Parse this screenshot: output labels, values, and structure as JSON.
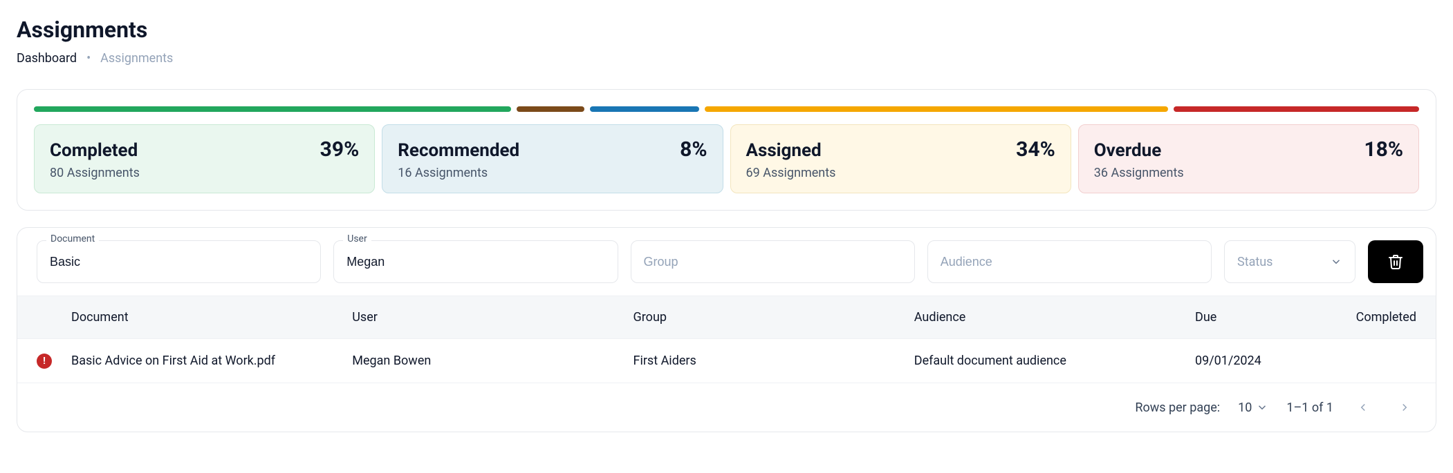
{
  "header": {
    "title": "Assignments"
  },
  "breadcrumb": {
    "items": [
      "Dashboard",
      "Assignments"
    ],
    "separator": "•"
  },
  "progress": {
    "segments": [
      {
        "colorClass": "seg-green",
        "weight": 35
      },
      {
        "colorClass": "seg-brown",
        "weight": 5
      },
      {
        "colorClass": "seg-blue",
        "weight": 8
      },
      {
        "colorClass": "seg-amber",
        "weight": 34
      },
      {
        "colorClass": "seg-red",
        "weight": 18
      }
    ]
  },
  "stats": {
    "completed": {
      "title": "Completed",
      "percent": "39%",
      "subtitle": "80 Assignments",
      "boxClass": "box-completed"
    },
    "recommended": {
      "title": "Recommended",
      "percent": "8%",
      "subtitle": "16 Assignments",
      "boxClass": "box-recommended"
    },
    "assigned": {
      "title": "Assigned",
      "percent": "34%",
      "subtitle": "69 Assignments",
      "boxClass": "box-assigned"
    },
    "overdue": {
      "title": "Overdue",
      "percent": "18%",
      "subtitle": "36 Assignments",
      "boxClass": "box-overdue"
    }
  },
  "filters": {
    "document": {
      "label": "Document",
      "value": "Basic"
    },
    "user": {
      "label": "User",
      "value": "Megan"
    },
    "group": {
      "placeholder": "Group",
      "value": ""
    },
    "audience": {
      "placeholder": "Audience",
      "value": ""
    },
    "status": {
      "placeholder": "Status",
      "value": ""
    }
  },
  "table": {
    "columns": {
      "document": "Document",
      "user": "User",
      "group": "Group",
      "audience": "Audience",
      "due": "Due",
      "completed": "Completed"
    },
    "rows": [
      {
        "alert": true,
        "document": "Basic Advice on First Aid at Work.pdf",
        "user": "Megan Bowen",
        "group": "First Aiders",
        "audience": "Default document audience",
        "due": "09/01/2024",
        "completed": ""
      }
    ]
  },
  "pagination": {
    "rowsPerPageLabel": "Rows per page:",
    "rowsPerPage": "10",
    "range": "1–1 of 1"
  },
  "icons": {
    "alert_glyph": "!"
  }
}
